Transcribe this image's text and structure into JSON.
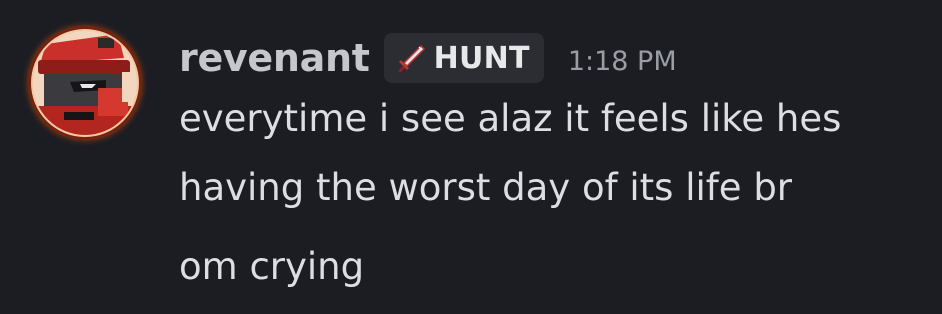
{
  "message": {
    "username": "revenant",
    "tag": {
      "icon": "sword-icon",
      "label": "HUNT"
    },
    "timestamp": "1:18 PM",
    "lines": [
      "everytime i see alaz it feels like hes",
      "having the worst day of its life br",
      "om crying"
    ]
  },
  "colors": {
    "background": "#1c1d22",
    "username": "#c5c7cc",
    "tag_background": "#2b2d33",
    "timestamp": "#9a9da5",
    "text": "#dcdee2",
    "avatar_ring": "#f07a26"
  }
}
